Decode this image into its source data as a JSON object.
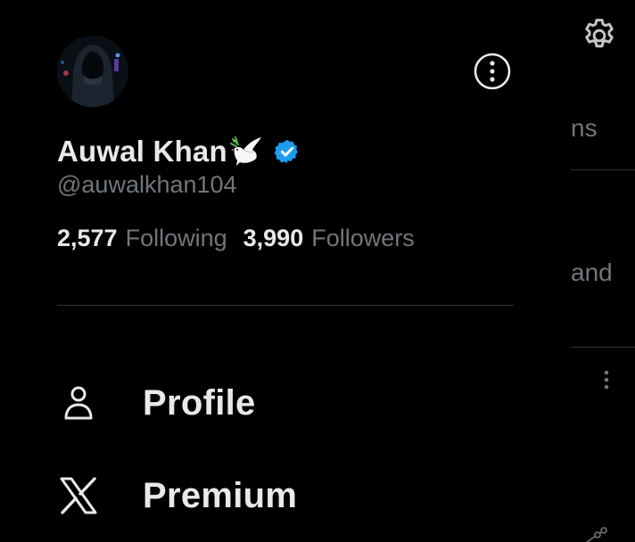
{
  "profile": {
    "display_name": "Auwal Khan",
    "name_emoji": "dove-emoji",
    "verified_badge": "verified-icon",
    "handle": "@auwalkhan104"
  },
  "stats": {
    "following_count": "2,577",
    "following_label": "Following",
    "followers_count": "3,990",
    "followers_label": "Followers"
  },
  "menu": [
    {
      "label": "Profile",
      "icon": "person-icon"
    },
    {
      "label": "Premium",
      "icon": "x-logo-icon"
    }
  ],
  "background": {
    "line1": "ns",
    "line2": "and"
  },
  "colors": {
    "background": "#000000",
    "text_primary": "#e7e9ea",
    "text_secondary": "#71767b",
    "divider": "#2f3336",
    "verified": "#1d9bf0"
  }
}
